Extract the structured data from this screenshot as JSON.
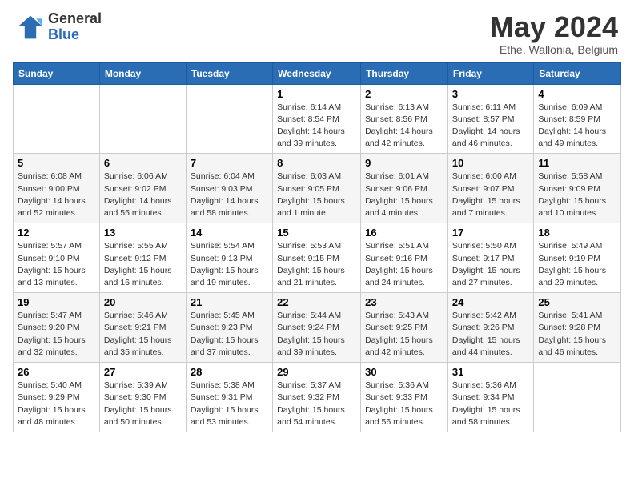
{
  "header": {
    "logo_general": "General",
    "logo_blue": "Blue",
    "month_title": "May 2024",
    "subtitle": "Ethe, Wallonia, Belgium"
  },
  "days_of_week": [
    "Sunday",
    "Monday",
    "Tuesday",
    "Wednesday",
    "Thursday",
    "Friday",
    "Saturday"
  ],
  "weeks": [
    [
      {
        "day": "",
        "sunrise": "",
        "sunset": "",
        "daylight": ""
      },
      {
        "day": "",
        "sunrise": "",
        "sunset": "",
        "daylight": ""
      },
      {
        "day": "",
        "sunrise": "",
        "sunset": "",
        "daylight": ""
      },
      {
        "day": "1",
        "sunrise": "Sunrise: 6:14 AM",
        "sunset": "Sunset: 8:54 PM",
        "daylight": "Daylight: 14 hours and 39 minutes."
      },
      {
        "day": "2",
        "sunrise": "Sunrise: 6:13 AM",
        "sunset": "Sunset: 8:56 PM",
        "daylight": "Daylight: 14 hours and 42 minutes."
      },
      {
        "day": "3",
        "sunrise": "Sunrise: 6:11 AM",
        "sunset": "Sunset: 8:57 PM",
        "daylight": "Daylight: 14 hours and 46 minutes."
      },
      {
        "day": "4",
        "sunrise": "Sunrise: 6:09 AM",
        "sunset": "Sunset: 8:59 PM",
        "daylight": "Daylight: 14 hours and 49 minutes."
      }
    ],
    [
      {
        "day": "5",
        "sunrise": "Sunrise: 6:08 AM",
        "sunset": "Sunset: 9:00 PM",
        "daylight": "Daylight: 14 hours and 52 minutes."
      },
      {
        "day": "6",
        "sunrise": "Sunrise: 6:06 AM",
        "sunset": "Sunset: 9:02 PM",
        "daylight": "Daylight: 14 hours and 55 minutes."
      },
      {
        "day": "7",
        "sunrise": "Sunrise: 6:04 AM",
        "sunset": "Sunset: 9:03 PM",
        "daylight": "Daylight: 14 hours and 58 minutes."
      },
      {
        "day": "8",
        "sunrise": "Sunrise: 6:03 AM",
        "sunset": "Sunset: 9:05 PM",
        "daylight": "Daylight: 15 hours and 1 minute."
      },
      {
        "day": "9",
        "sunrise": "Sunrise: 6:01 AM",
        "sunset": "Sunset: 9:06 PM",
        "daylight": "Daylight: 15 hours and 4 minutes."
      },
      {
        "day": "10",
        "sunrise": "Sunrise: 6:00 AM",
        "sunset": "Sunset: 9:07 PM",
        "daylight": "Daylight: 15 hours and 7 minutes."
      },
      {
        "day": "11",
        "sunrise": "Sunrise: 5:58 AM",
        "sunset": "Sunset: 9:09 PM",
        "daylight": "Daylight: 15 hours and 10 minutes."
      }
    ],
    [
      {
        "day": "12",
        "sunrise": "Sunrise: 5:57 AM",
        "sunset": "Sunset: 9:10 PM",
        "daylight": "Daylight: 15 hours and 13 minutes."
      },
      {
        "day": "13",
        "sunrise": "Sunrise: 5:55 AM",
        "sunset": "Sunset: 9:12 PM",
        "daylight": "Daylight: 15 hours and 16 minutes."
      },
      {
        "day": "14",
        "sunrise": "Sunrise: 5:54 AM",
        "sunset": "Sunset: 9:13 PM",
        "daylight": "Daylight: 15 hours and 19 minutes."
      },
      {
        "day": "15",
        "sunrise": "Sunrise: 5:53 AM",
        "sunset": "Sunset: 9:15 PM",
        "daylight": "Daylight: 15 hours and 21 minutes."
      },
      {
        "day": "16",
        "sunrise": "Sunrise: 5:51 AM",
        "sunset": "Sunset: 9:16 PM",
        "daylight": "Daylight: 15 hours and 24 minutes."
      },
      {
        "day": "17",
        "sunrise": "Sunrise: 5:50 AM",
        "sunset": "Sunset: 9:17 PM",
        "daylight": "Daylight: 15 hours and 27 minutes."
      },
      {
        "day": "18",
        "sunrise": "Sunrise: 5:49 AM",
        "sunset": "Sunset: 9:19 PM",
        "daylight": "Daylight: 15 hours and 29 minutes."
      }
    ],
    [
      {
        "day": "19",
        "sunrise": "Sunrise: 5:47 AM",
        "sunset": "Sunset: 9:20 PM",
        "daylight": "Daylight: 15 hours and 32 minutes."
      },
      {
        "day": "20",
        "sunrise": "Sunrise: 5:46 AM",
        "sunset": "Sunset: 9:21 PM",
        "daylight": "Daylight: 15 hours and 35 minutes."
      },
      {
        "day": "21",
        "sunrise": "Sunrise: 5:45 AM",
        "sunset": "Sunset: 9:23 PM",
        "daylight": "Daylight: 15 hours and 37 minutes."
      },
      {
        "day": "22",
        "sunrise": "Sunrise: 5:44 AM",
        "sunset": "Sunset: 9:24 PM",
        "daylight": "Daylight: 15 hours and 39 minutes."
      },
      {
        "day": "23",
        "sunrise": "Sunrise: 5:43 AM",
        "sunset": "Sunset: 9:25 PM",
        "daylight": "Daylight: 15 hours and 42 minutes."
      },
      {
        "day": "24",
        "sunrise": "Sunrise: 5:42 AM",
        "sunset": "Sunset: 9:26 PM",
        "daylight": "Daylight: 15 hours and 44 minutes."
      },
      {
        "day": "25",
        "sunrise": "Sunrise: 5:41 AM",
        "sunset": "Sunset: 9:28 PM",
        "daylight": "Daylight: 15 hours and 46 minutes."
      }
    ],
    [
      {
        "day": "26",
        "sunrise": "Sunrise: 5:40 AM",
        "sunset": "Sunset: 9:29 PM",
        "daylight": "Daylight: 15 hours and 48 minutes."
      },
      {
        "day": "27",
        "sunrise": "Sunrise: 5:39 AM",
        "sunset": "Sunset: 9:30 PM",
        "daylight": "Daylight: 15 hours and 50 minutes."
      },
      {
        "day": "28",
        "sunrise": "Sunrise: 5:38 AM",
        "sunset": "Sunset: 9:31 PM",
        "daylight": "Daylight: 15 hours and 53 minutes."
      },
      {
        "day": "29",
        "sunrise": "Sunrise: 5:37 AM",
        "sunset": "Sunset: 9:32 PM",
        "daylight": "Daylight: 15 hours and 54 minutes."
      },
      {
        "day": "30",
        "sunrise": "Sunrise: 5:36 AM",
        "sunset": "Sunset: 9:33 PM",
        "daylight": "Daylight: 15 hours and 56 minutes."
      },
      {
        "day": "31",
        "sunrise": "Sunrise: 5:36 AM",
        "sunset": "Sunset: 9:34 PM",
        "daylight": "Daylight: 15 hours and 58 minutes."
      },
      {
        "day": "",
        "sunrise": "",
        "sunset": "",
        "daylight": ""
      }
    ]
  ]
}
